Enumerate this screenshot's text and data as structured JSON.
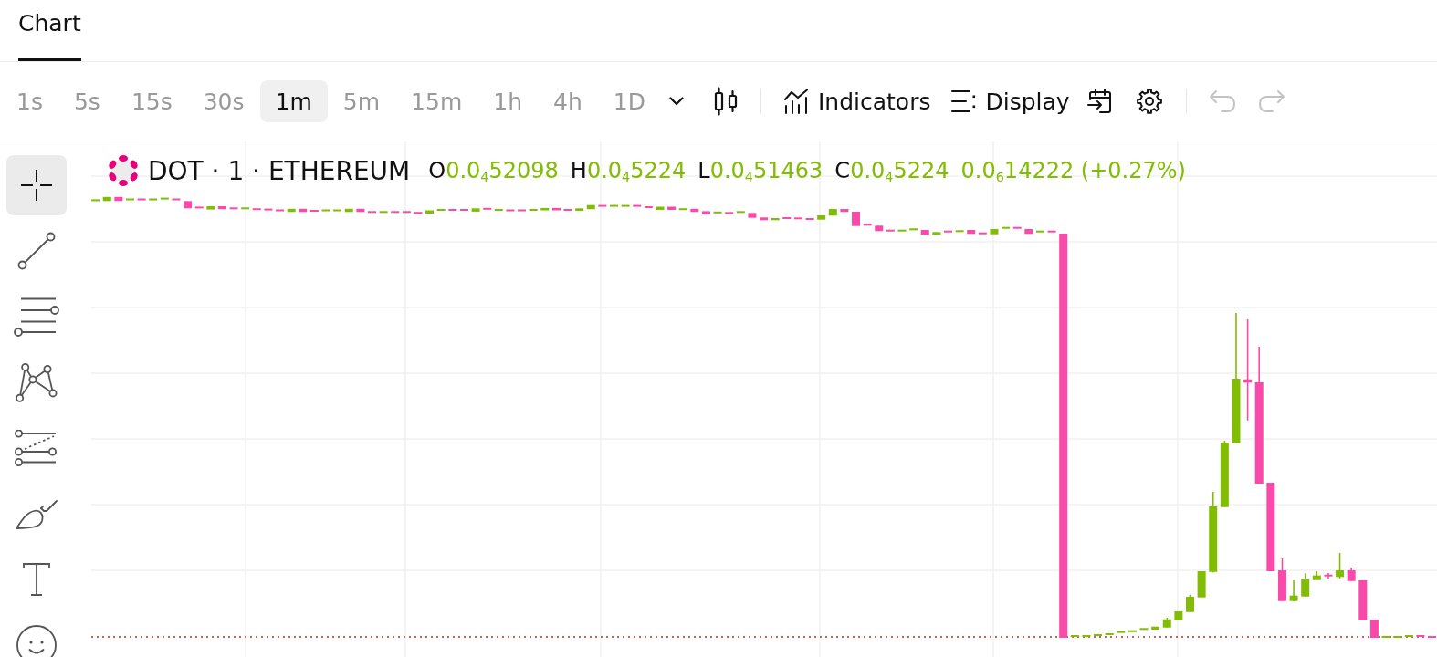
{
  "tabs": [
    {
      "label": "Chart",
      "selected": true
    }
  ],
  "intervals": [
    {
      "label": "1s",
      "selected": false
    },
    {
      "label": "5s",
      "selected": false
    },
    {
      "label": "15s",
      "selected": false
    },
    {
      "label": "30s",
      "selected": false
    },
    {
      "label": "1m",
      "selected": true
    },
    {
      "label": "5m",
      "selected": false
    },
    {
      "label": "15m",
      "selected": false
    },
    {
      "label": "1h",
      "selected": false
    },
    {
      "label": "4h",
      "selected": false
    },
    {
      "label": "1D",
      "selected": false
    }
  ],
  "toolbar_buttons": [
    {
      "kind": "indicators",
      "label": "Indicators"
    },
    {
      "kind": "display",
      "label": "Display"
    }
  ],
  "history": [
    {
      "kind": "undo",
      "disabled": true
    },
    {
      "kind": "redo",
      "disabled": true
    }
  ],
  "drawing_tools": [
    {
      "kind": "crosshair",
      "selected": true
    },
    {
      "kind": "trend_line",
      "selected": false
    },
    {
      "kind": "parallel_lines",
      "selected": false
    },
    {
      "kind": "pattern",
      "selected": false
    },
    {
      "kind": "fib",
      "selected": false
    },
    {
      "kind": "brush",
      "selected": false
    },
    {
      "kind": "text",
      "selected": false
    },
    {
      "kind": "emoji",
      "selected": false
    }
  ],
  "legend": {
    "symbol": "DOT · 1 · ETHEREUM",
    "ohlc": [
      {
        "label": "O",
        "value": "0.0$_{4}$52098"
      },
      {
        "label": "H",
        "value": "0.0$_{4}$5224"
      },
      {
        "label": "L",
        "value": "0.0$_{4}$51463"
      },
      {
        "label": "C",
        "value": "0.0$_{4}$5224"
      }
    ],
    "change": "0.0$_{6}$14222 (+0.27%)"
  }
}
